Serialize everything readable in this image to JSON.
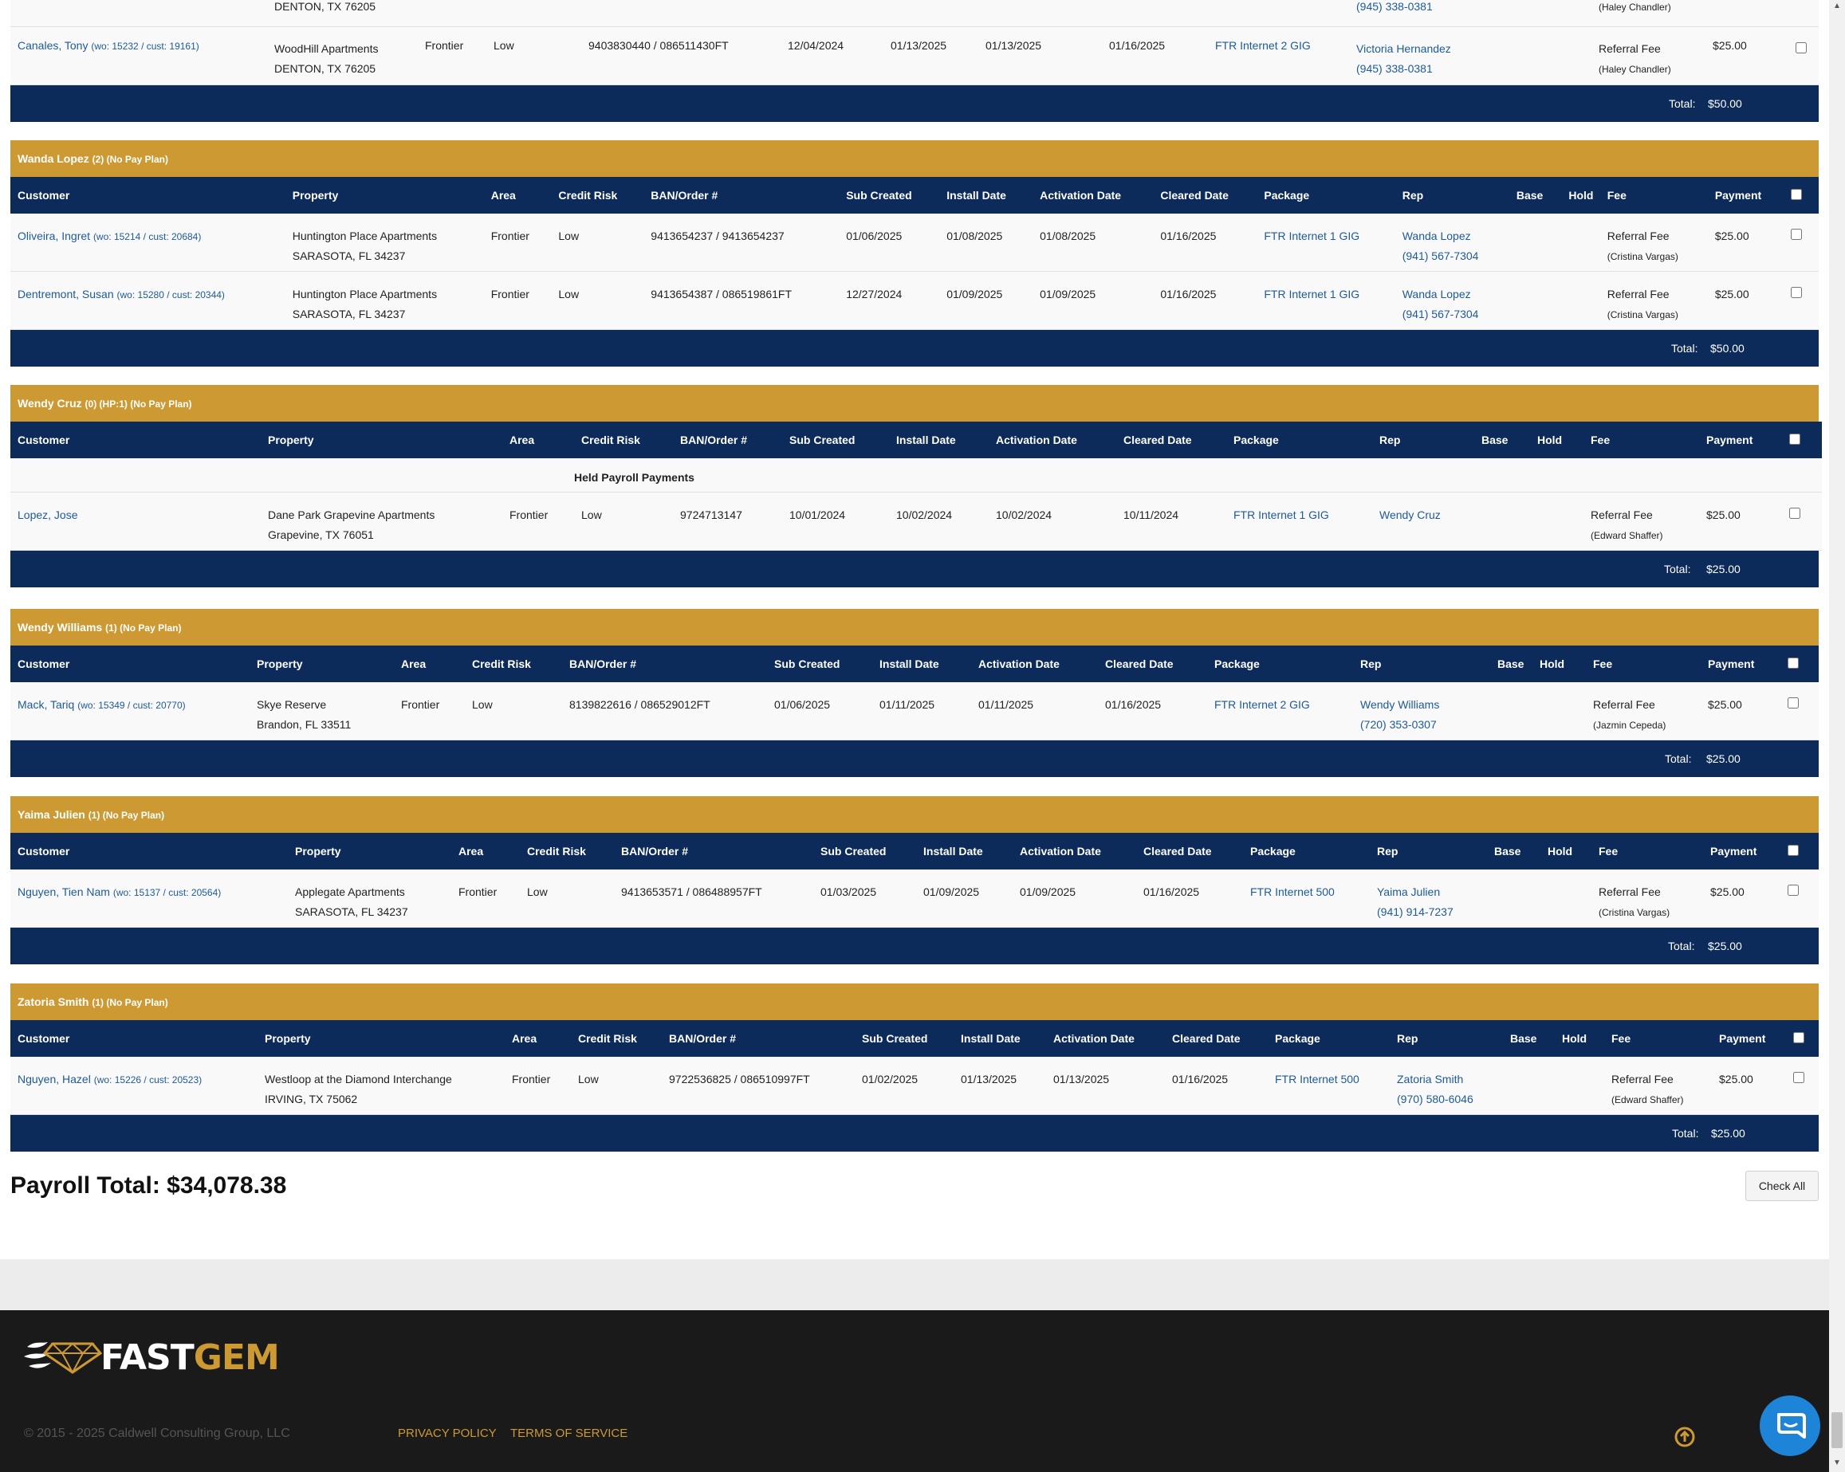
{
  "top": {
    "prev_row": {
      "city": "DENTON, TX 76205",
      "rep_phone": "(945) 338-0381",
      "fee_sub": "(Haley Chandler)"
    },
    "row": {
      "customer": "Canales, Tony",
      "wo": "(wo: 15232 / cust: 19161)",
      "property": "WoodHill Apartments",
      "city": "DENTON, TX 76205",
      "area": "Frontier",
      "credit": "Low",
      "ban": "9403830440 / 086511430FT",
      "sub": "12/04/2024",
      "install": "01/13/2025",
      "activation": "01/13/2025",
      "cleared": "01/16/2025",
      "package": "FTR Internet 2 GIG",
      "rep": "Victoria Hernandez",
      "rep_phone": "(945) 338-0381",
      "fee": "Referral Fee",
      "fee_sub": "(Haley Chandler)",
      "payment": "$25.00"
    },
    "total_label": "Total:",
    "total_value": "$50.00"
  },
  "headers": {
    "customer": "Customer",
    "property": "Property",
    "area": "Area",
    "credit": "Credit Risk",
    "ban": "BAN/Order #",
    "sub": "Sub Created",
    "install": "Install Date",
    "activation": "Activation Date",
    "cleared": "Cleared Date",
    "package": "Package",
    "rep": "Rep",
    "base": "Base",
    "hold": "Hold",
    "fee": "Fee",
    "payment": "Payment"
  },
  "groups": [
    {
      "name": "Wanda Lopez",
      "meta": "(2) (No Pay Plan)",
      "held_label": "",
      "rows": [
        {
          "customer": "Oliveira, Ingret",
          "wo": "(wo: 15214 / cust: 20684)",
          "property": "Huntington Place Apartments",
          "city": "SARASOTA, FL 34237",
          "area": "Frontier",
          "credit": "Low",
          "ban": "9413654237 / 9413654237",
          "sub": "01/06/2025",
          "install": "01/08/2025",
          "activation": "01/08/2025",
          "cleared": "01/16/2025",
          "package": "FTR Internet 1 GIG",
          "rep": "Wanda Lopez",
          "rep_phone": "(941) 567-7304",
          "fee": "Referral Fee",
          "fee_sub": "(Cristina Vargas)",
          "payment": "$25.00"
        },
        {
          "customer": "Dentremont, Susan",
          "wo": "(wo: 15280 / cust: 20344)",
          "property": "Huntington Place Apartments",
          "city": "SARASOTA, FL 34237",
          "area": "Frontier",
          "credit": "Low",
          "ban": "9413654387 / 086519861FT",
          "sub": "12/27/2024",
          "install": "01/09/2025",
          "activation": "01/09/2025",
          "cleared": "01/16/2025",
          "package": "FTR Internet 1 GIG",
          "rep": "Wanda Lopez",
          "rep_phone": "(941) 567-7304",
          "fee": "Referral Fee",
          "fee_sub": "(Cristina Vargas)",
          "payment": "$25.00"
        }
      ],
      "total_label": "Total:",
      "total_value": "$50.00"
    },
    {
      "name": "Wendy Cruz",
      "meta": "(0) (HP:1) (No Pay Plan)",
      "held_label": "Held Payroll Payments",
      "rows": [
        {
          "customer": "Lopez, Jose",
          "wo": "",
          "property": "Dane Park Grapevine Apartments",
          "city": "Grapevine, TX 76051",
          "area": "Frontier",
          "credit": "Low",
          "ban": "9724713147",
          "sub": "10/01/2024",
          "install": "10/02/2024",
          "activation": "10/02/2024",
          "cleared": "10/11/2024",
          "package": "FTR Internet 1 GIG",
          "rep": "Wendy Cruz",
          "rep_phone": "",
          "fee": "Referral Fee",
          "fee_sub": "(Edward Shaffer)",
          "payment": "$25.00"
        }
      ],
      "total_label": "Total:",
      "total_value": "$25.00"
    },
    {
      "name": "Wendy Williams",
      "meta": "(1) (No Pay Plan)",
      "held_label": "",
      "rows": [
        {
          "customer": "Mack, Tariq",
          "wo": "(wo: 15349 / cust: 20770)",
          "property": "Skye Reserve",
          "city": "Brandon, FL 33511",
          "area": "Frontier",
          "credit": "Low",
          "ban": "8139822616 / 086529012FT",
          "sub": "01/06/2025",
          "install": "01/11/2025",
          "activation": "01/11/2025",
          "cleared": "01/16/2025",
          "package": "FTR Internet 2 GIG",
          "rep": "Wendy Williams",
          "rep_phone": "(720) 353-0307",
          "fee": "Referral Fee",
          "fee_sub": "(Jazmin Cepeda)",
          "payment": "$25.00"
        }
      ],
      "total_label": "Total:",
      "total_value": "$25.00"
    },
    {
      "name": "Yaima Julien",
      "meta": "(1) (No Pay Plan)",
      "held_label": "",
      "rows": [
        {
          "customer": "Nguyen, Tien Nam",
          "wo": "(wo: 15137 / cust: 20564)",
          "property": "Applegate Apartments",
          "city": "SARASOTA, FL 34237",
          "area": "Frontier",
          "credit": "Low",
          "ban": "9413653571 / 086488957FT",
          "sub": "01/03/2025",
          "install": "01/09/2025",
          "activation": "01/09/2025",
          "cleared": "01/16/2025",
          "package": "FTR Internet 500",
          "rep": "Yaima Julien",
          "rep_phone": "(941) 914-7237",
          "fee": "Referral Fee",
          "fee_sub": "(Cristina Vargas)",
          "payment": "$25.00"
        }
      ],
      "total_label": "Total:",
      "total_value": "$25.00"
    },
    {
      "name": "Zatoria Smith",
      "meta": "(1) (No Pay Plan)",
      "held_label": "",
      "rows": [
        {
          "customer": "Nguyen, Hazel",
          "wo": "(wo: 15226 / cust: 20523)",
          "property": "Westloop at the Diamond Interchange",
          "city": "IRVING, TX 75062",
          "area": "Frontier",
          "credit": "Low",
          "ban": "9722536825 / 086510997FT",
          "sub": "01/02/2025",
          "install": "01/13/2025",
          "activation": "01/13/2025",
          "cleared": "01/16/2025",
          "package": "FTR Internet 500",
          "rep": "Zatoria Smith",
          "rep_phone": "(970) 580-6046",
          "fee": "Referral Fee",
          "fee_sub": "(Edward Shaffer)",
          "payment": "$25.00"
        }
      ],
      "total_label": "Total:",
      "total_value": "$25.00"
    }
  ],
  "payroll_total": "Payroll Total: $34,078.38",
  "check_all": "Check All",
  "footer": {
    "logo_fast": "FAST",
    "logo_gem": "GEM",
    "copyright": "© 2015 - 2025 Caldwell Consulting Group, LLC",
    "privacy": "PRIVACY POLICY",
    "terms": "TERMS OF SERVICE"
  },
  "icons": [
    "diamond-logo-icon",
    "scroll-up-icon",
    "chat-icon",
    "checkbox-icon"
  ],
  "colors": {
    "gold": "#cc9933",
    "navy": "#0c2b5a",
    "link": "#1d5a99",
    "footer": "#1a1a1a",
    "chat": "#1e84d8"
  }
}
